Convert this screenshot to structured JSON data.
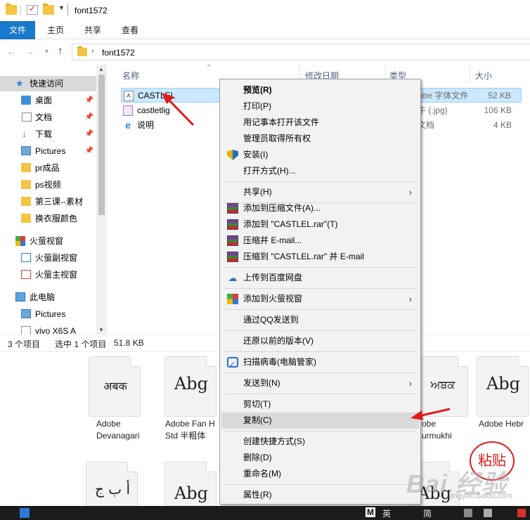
{
  "window": {
    "title": "font1572"
  },
  "ribbon": {
    "tabs": [
      "文件",
      "主页",
      "共享",
      "查看"
    ]
  },
  "address": {
    "path": "font1572"
  },
  "navpane": {
    "items": [
      {
        "label": "快速访问",
        "icon": "star-icon",
        "pinned": false,
        "selected": true
      },
      {
        "label": "桌面",
        "icon": "desktop-icon",
        "pinned": true
      },
      {
        "label": "文档",
        "icon": "documents-icon",
        "pinned": true
      },
      {
        "label": "下载",
        "icon": "download-icon",
        "pinned": true
      },
      {
        "label": "Pictures",
        "icon": "pictures-icon",
        "pinned": true
      },
      {
        "label": "pr成品",
        "icon": "folder-icon",
        "pinned": false
      },
      {
        "label": "ps视频",
        "icon": "folder-icon",
        "pinned": false
      },
      {
        "label": "第三课--素材",
        "icon": "folder-icon",
        "pinned": false
      },
      {
        "label": "换衣服颜色",
        "icon": "folder-icon",
        "pinned": false
      },
      {
        "label": "火萤视窗",
        "icon": "huoying-icon",
        "pinned": false
      },
      {
        "label": "火萤副视窗",
        "icon": "window-icon",
        "pinned": false
      },
      {
        "label": "火萤主视窗",
        "icon": "window-icon",
        "pinned": false
      },
      {
        "label": "此电脑",
        "icon": "computer-icon",
        "pinned": false
      },
      {
        "label": "Pictures",
        "icon": "pictures-icon",
        "pinned": false
      },
      {
        "label": "vivo X6S A",
        "icon": "phone-icon",
        "pinned": false
      }
    ]
  },
  "filelist": {
    "columns": {
      "name": "名称",
      "modified": "修改日期",
      "type": "类型",
      "size": "大小"
    },
    "rows": [
      {
        "name": "CASTLEL",
        "type": "obe 字体文件",
        "size": "52 KB",
        "icon": "font-file-icon",
        "selected": true
      },
      {
        "name": "castletlig",
        "type": "牛 (.jpg)",
        "size": "106 KB",
        "icon": "image-file-icon",
        "selected": false
      },
      {
        "name": "说明",
        "type": "文档",
        "size": "4 KB",
        "icon": "ie-icon",
        "selected": false
      }
    ]
  },
  "status": {
    "count": "3 个项目",
    "selected": "选中 1 个项目",
    "size": "51.8 KB"
  },
  "gallery": {
    "cards": [
      {
        "sample": "अबक",
        "label1": "Adobe",
        "label2": "Devanagari"
      },
      {
        "sample": "Abg",
        "label1": "Adobe Fan H",
        "label2": "Std 半粗体"
      },
      {
        "sample": "ਅਬਕ",
        "label1": "obe",
        "label2": "urmukhi"
      },
      {
        "sample": "Abg",
        "label1": "Adobe Hebr",
        "label2": ""
      },
      {
        "sample": "أ ب ج",
        "label1": "",
        "label2": ""
      },
      {
        "sample": "Abg",
        "label1": "",
        "label2": ""
      },
      {
        "sample": "Abg",
        "label1": "",
        "label2": ""
      }
    ]
  },
  "context_menu": {
    "items": [
      {
        "label": "预览(R)",
        "bold": true
      },
      {
        "label": "打印(P)"
      },
      {
        "label": "用记事本打开该文件"
      },
      {
        "label": "管理员取得所有权"
      },
      {
        "label": "安装(I)",
        "icon": "uac-shield-icon"
      },
      {
        "label": "打开方式(H)..."
      },
      {
        "label": "共享(H)",
        "submenu": true
      },
      {
        "label": "添加到压缩文件(A)...",
        "icon": "winrar-icon"
      },
      {
        "label": "添加到 \"CASTLEL.rar\"(T)",
        "icon": "winrar-icon"
      },
      {
        "label": "压缩并 E-mail...",
        "icon": "winrar-icon"
      },
      {
        "label": "压缩到 \"CASTLEL.rar\" 并 E-mail",
        "icon": "winrar-icon"
      },
      {
        "label": "上传到百度网盘",
        "icon": "baidu-cloud-icon"
      },
      {
        "label": "添加到火萤视窗",
        "icon": "huoying-icon",
        "submenu": true
      },
      {
        "label": "通过QQ发送到"
      },
      {
        "label": "还原以前的版本(V)"
      },
      {
        "label": "扫描病毒(电脑管家)",
        "icon": "tencent-guard-icon"
      },
      {
        "label": "发送到(N)",
        "submenu": true
      },
      {
        "label": "剪切(T)"
      },
      {
        "label": "复制(C)",
        "highlighted": true
      },
      {
        "label": "创建快捷方式(S)"
      },
      {
        "label": "删除(D)"
      },
      {
        "label": "重命名(M)"
      },
      {
        "label": "属性(R)"
      }
    ]
  },
  "annotations": {
    "paste_stamp": "粘贴",
    "watermark": "Bai 经验",
    "watermark_sub": "jingyan.baidu.com",
    "arrow_color": "#e01b1b"
  },
  "taskbar": {
    "items": [
      "M",
      "英",
      "简"
    ]
  },
  "colors": {
    "accent": "#1979ca",
    "selection": "#cce8ff",
    "menu_bg": "#f2f2f2",
    "menu_hover": "#dadada"
  }
}
